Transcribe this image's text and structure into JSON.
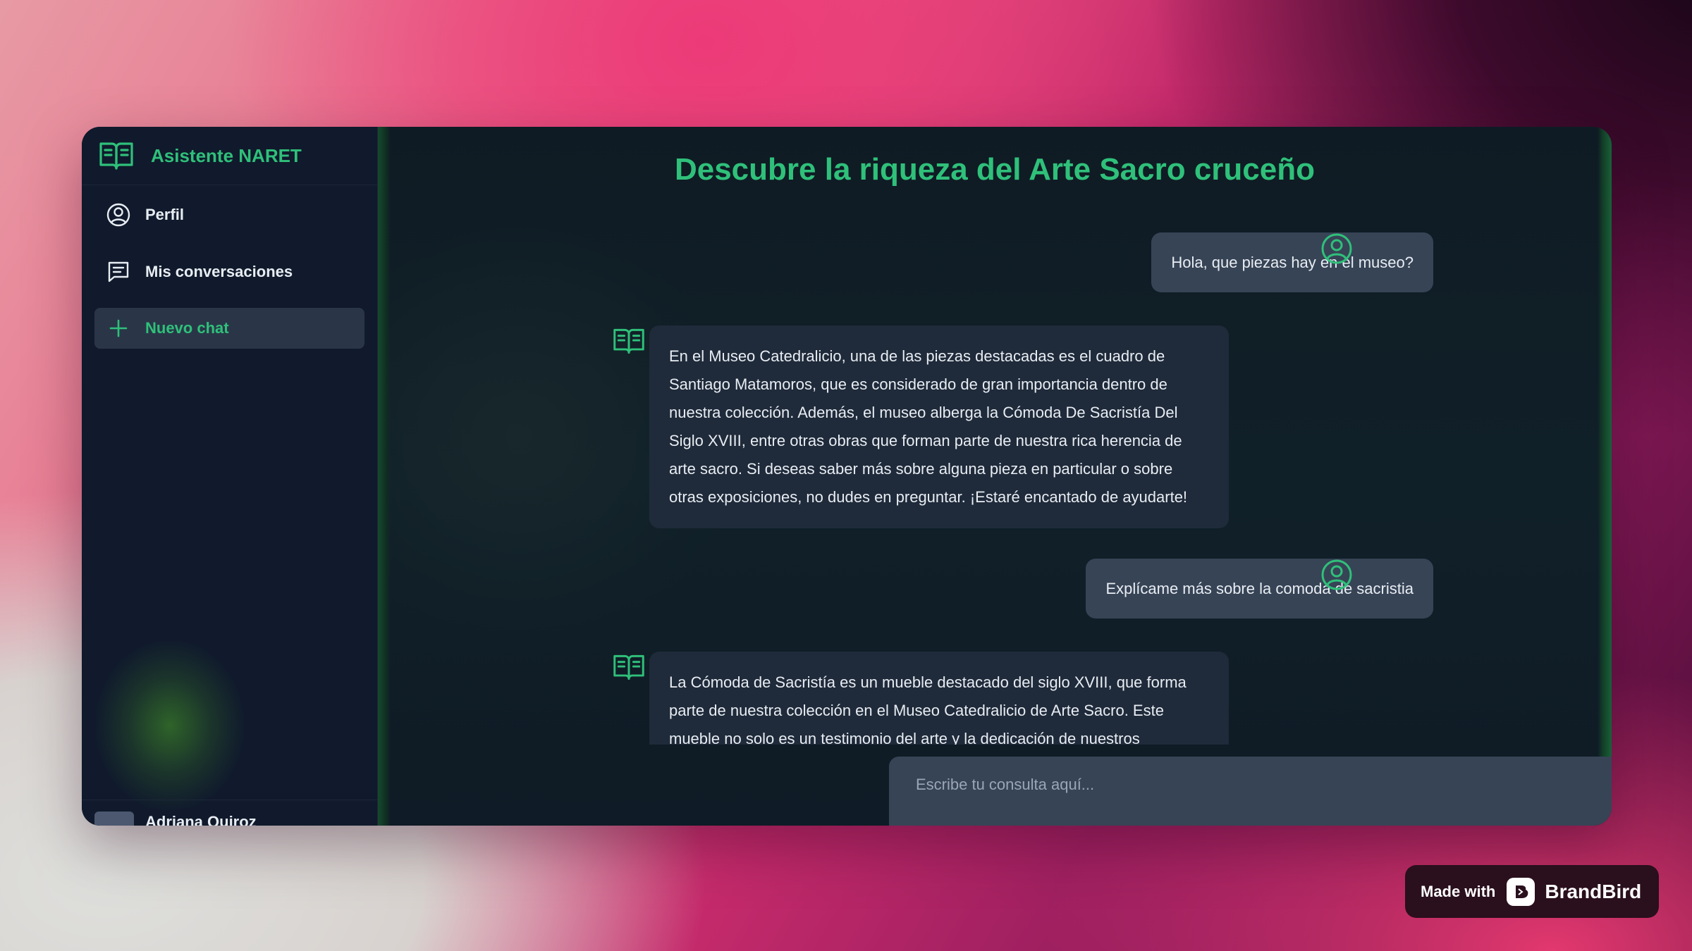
{
  "app": {
    "brand_name": "Asistente NARET",
    "page_title": "Descubre la riqueza del Arte Sacro cruceño"
  },
  "sidebar": {
    "items": [
      {
        "label": "Perfil",
        "icon": "user-circle-icon"
      },
      {
        "label": "Mis conversaciones",
        "icon": "chat-bubble-icon"
      },
      {
        "label": "Nuevo chat",
        "icon": "plus-icon"
      }
    ],
    "user_name": "Adriana Quiroz"
  },
  "chat": {
    "messages": [
      {
        "role": "user",
        "text": "Hola, que piezas hay en el museo?"
      },
      {
        "role": "assistant",
        "text": "En el Museo Catedralicio, una de las piezas destacadas es el cuadro de Santiago Matamoros, que es considerado de gran importancia dentro de nuestra colección. Además, el museo alberga la Cómoda De Sacristía Del Siglo XVIII, entre otras obras que forman parte de nuestra rica herencia de arte sacro. Si deseas saber más sobre alguna pieza en particular o sobre otras exposiciones, no dudes en preguntar. ¡Estaré encantado de ayudarte!"
      },
      {
        "role": "user",
        "text": "Explícame más sobre la comoda de sacristia"
      },
      {
        "role": "assistant",
        "text": "La Cómoda de Sacristía es un mueble destacado del siglo XVIII, que forma parte de nuestra colección en el Museo Catedralicio de Arte Sacro. Este mueble no solo es un testimonio del arte y la dedicación de nuestros"
      }
    ]
  },
  "composer": {
    "placeholder": "Escribe tu consulta aquí...",
    "send_icon": "send-icon"
  },
  "badge": {
    "made_with": "Made with",
    "brand": "BrandBird"
  },
  "colors": {
    "accent": "#2fc07a",
    "sidebar_bg": "#101a2c",
    "bubble_user": "#374456",
    "bubble_bot": "#1f2a3a"
  }
}
